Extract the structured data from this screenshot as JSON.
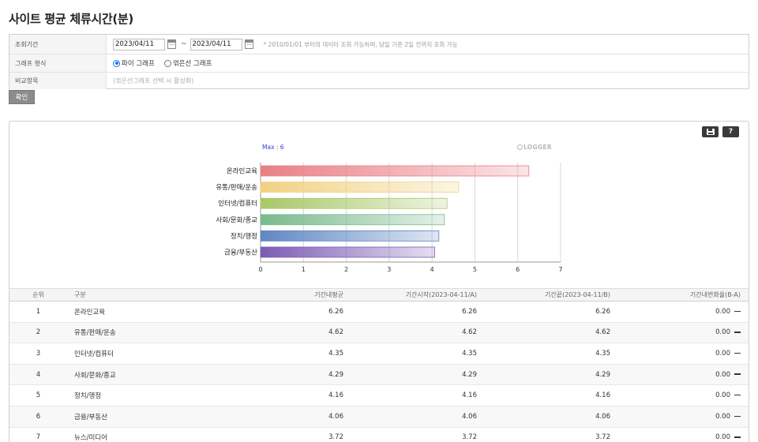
{
  "page": {
    "title": "사이트 평균 체류시간(분)"
  },
  "filter": {
    "period_label": "조회기간",
    "start_date": "2023/04/11",
    "tilde": "~",
    "end_date": "2023/04/11",
    "date_note": "* 2010/01/01 부터의 데이터 조회 가능하며, 당일 기준 2일 전까지 조회 가능",
    "graph_label": "그래프 형식",
    "radio_pie": "파이 그래프",
    "radio_line": "꺾은선 그래프",
    "selected_graph": "pie",
    "compare_label": "비교항목",
    "compare_note": "(꺾은선그래프 선택 시 활성화)",
    "confirm_label": "확인"
  },
  "toolbar": {
    "save_icon": "save-icon",
    "help_label": "?"
  },
  "chart": {
    "max_label": "Max : 6",
    "logo_text": "LOGGER"
  },
  "chart_data": {
    "type": "bar",
    "orientation": "horizontal",
    "categories": [
      "온라인교육",
      "유통/판매/운송",
      "인터넷/컴퓨터",
      "사회/문화/종교",
      "정치/행정",
      "금융/부동산"
    ],
    "values": [
      6.26,
      4.62,
      4.35,
      4.29,
      4.16,
      4.06
    ],
    "colors": [
      "#e87f86",
      "#f1d183",
      "#a9c769",
      "#79b98d",
      "#5f87c4",
      "#7b5bb4"
    ],
    "xlim": [
      0,
      7
    ],
    "xticks": [
      "0",
      "1",
      "2",
      "3",
      "4",
      "5",
      "6",
      "7"
    ],
    "grid": true
  },
  "table": {
    "headers": [
      "순위",
      "구분",
      "기간내평균",
      "기간시작(2023-04-11/A)",
      "기간끝(2023-04-11/B)",
      "기간내변화율(B-A)"
    ],
    "rows": [
      [
        "1",
        "온라인교육",
        "6.26",
        "6.26",
        "6.26",
        "0.00"
      ],
      [
        "2",
        "유통/판매/운송",
        "4.62",
        "4.62",
        "4.62",
        "0.00"
      ],
      [
        "3",
        "인터넷/컴퓨터",
        "4.35",
        "4.35",
        "4.35",
        "0.00"
      ],
      [
        "4",
        "사회/문화/종교",
        "4.29",
        "4.29",
        "4.29",
        "0.00"
      ],
      [
        "5",
        "정치/행정",
        "4.16",
        "4.16",
        "4.16",
        "0.00"
      ],
      [
        "6",
        "금융/부동산",
        "4.06",
        "4.06",
        "4.06",
        "0.00"
      ],
      [
        "7",
        "뉴스/미디어",
        "3.72",
        "3.72",
        "3.72",
        "0.00"
      ]
    ]
  }
}
